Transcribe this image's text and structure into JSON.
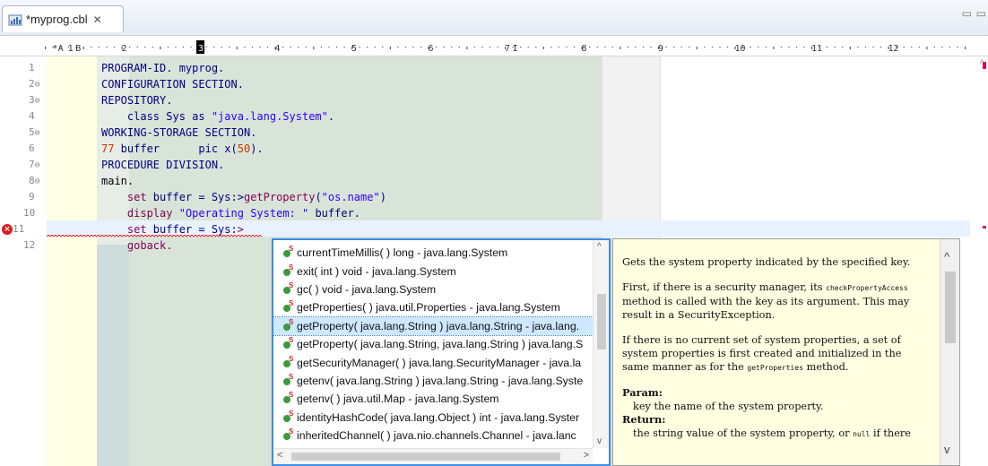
{
  "tab": {
    "label": "*myprog.cbl",
    "close": "✕"
  },
  "window": {
    "minimize": "▭",
    "maximize": "▭"
  },
  "ruler": {
    "labels": [
      {
        "text": "*A",
        "col": 1
      },
      {
        "text": "1",
        "col": 3
      },
      {
        "text": "B",
        "col": 4
      },
      {
        "text": "2",
        "col": 10
      },
      {
        "text": "3",
        "col": 20
      },
      {
        "text": "4",
        "col": 30
      },
      {
        "text": "5",
        "col": 40
      },
      {
        "text": "6",
        "col": 50
      },
      {
        "text": "7",
        "col": 60
      },
      {
        "text": "I",
        "col": 61
      },
      {
        "text": "8",
        "col": 70
      },
      {
        "text": "9",
        "col": 80
      },
      {
        "text": "10",
        "col": 90
      },
      {
        "text": "11",
        "col": 100
      },
      {
        "text": "12",
        "col": 110
      }
    ]
  },
  "lines": [
    {
      "n": "1",
      "fold": "",
      "segs": [
        {
          "t": "PROGRAM-ID. myprog.",
          "c": "kw"
        }
      ]
    },
    {
      "n": "2",
      "fold": "⊖",
      "segs": [
        {
          "t": "CONFIGURATION SECTION.",
          "c": "kw"
        }
      ]
    },
    {
      "n": "3",
      "fold": "⊖",
      "segs": [
        {
          "t": "REPOSITORY.",
          "c": "kw"
        }
      ]
    },
    {
      "n": "4",
      "fold": "",
      "segs": [
        {
          "t": "    class Sys as ",
          "c": "kw"
        },
        {
          "t": "\"java.lang.System\"",
          "c": "str"
        },
        {
          "t": ".",
          "c": "kw"
        }
      ]
    },
    {
      "n": "5",
      "fold": "⊖",
      "segs": [
        {
          "t": "WORKING-STORAGE SECTION.",
          "c": "kw"
        }
      ]
    },
    {
      "n": "6",
      "fold": "",
      "segs": [
        {
          "t": "77",
          "c": "num"
        },
        {
          "t": " buffer      pic x(",
          "c": "kw"
        },
        {
          "t": "50",
          "c": "num"
        },
        {
          "t": ").",
          "c": "kw"
        }
      ]
    },
    {
      "n": "7",
      "fold": "⊖",
      "segs": [
        {
          "t": "PROCEDURE DIVISION.",
          "c": "kw"
        }
      ]
    },
    {
      "n": "8",
      "fold": "⊖",
      "segs": [
        {
          "t": "main.",
          "c": "plain"
        }
      ]
    },
    {
      "n": "9",
      "fold": "",
      "segs": [
        {
          "t": "    set",
          "c": "kw2"
        },
        {
          "t": " buffer = Sys:>",
          "c": "kw"
        },
        {
          "t": "getProperty",
          "c": "kw2"
        },
        {
          "t": "(",
          "c": "kw"
        },
        {
          "t": "\"os.name\"",
          "c": "str"
        },
        {
          "t": ")",
          "c": "kw"
        }
      ]
    },
    {
      "n": "10",
      "fold": "",
      "segs": [
        {
          "t": "    display",
          "c": "kw2"
        },
        {
          "t": " ",
          "c": "kw"
        },
        {
          "t": "\"Operating System: \"",
          "c": "str"
        },
        {
          "t": " buffer.",
          "c": "kw"
        }
      ]
    },
    {
      "n": "11",
      "fold": "",
      "err": true,
      "segs": [
        {
          "t": "    set",
          "c": "kw2"
        },
        {
          "t": " buffer = Sys:",
          "c": "kw"
        },
        {
          "t": ">",
          "c": "kw2"
        }
      ]
    },
    {
      "n": "12",
      "fold": "",
      "segs": [
        {
          "t": "    goback.",
          "c": "kw2"
        }
      ]
    }
  ],
  "assist": {
    "items": [
      "currentTimeMillis( ) long - java.lang.System",
      "exit( int ) void - java.lang.System",
      "gc( ) void - java.lang.System",
      "getProperties( ) java.util.Properties - java.lang.System",
      "getProperty( java.lang.String ) java.lang.String - java.lang.",
      "getProperty( java.lang.String, java.lang.String ) java.lang.S",
      "getSecurityManager( ) java.lang.SecurityManager - java.la",
      "getenv( java.lang.String ) java.lang.String - java.lang.Syste",
      "getenv( ) java.util.Map - java.lang.System",
      "identityHashCode( java.lang.Object ) int - java.lang.Syster",
      "inheritedChannel( ) java.nio.channels.Channel - java.lanc"
    ],
    "selected_index": 4
  },
  "doc": {
    "summary": "Gets the system property indicated by the specified key.",
    "p1_a": "First, if there is a security manager, its ",
    "p1_code": "checkPropertyAccess",
    "p1_b": " method is called with the key as its argument. This may result in a SecurityException.",
    "p2_a": "If there is no current set of system properties, a set of system properties is first created and initialized in the same manner as for the ",
    "p2_code": "getProperties",
    "p2_b": " method.",
    "param_label": "Param",
    "param_text": "key the name of the system property.",
    "return_label": "Return",
    "return_a": "the string value of the system property, or ",
    "return_code": "null",
    "return_b": " if there"
  }
}
